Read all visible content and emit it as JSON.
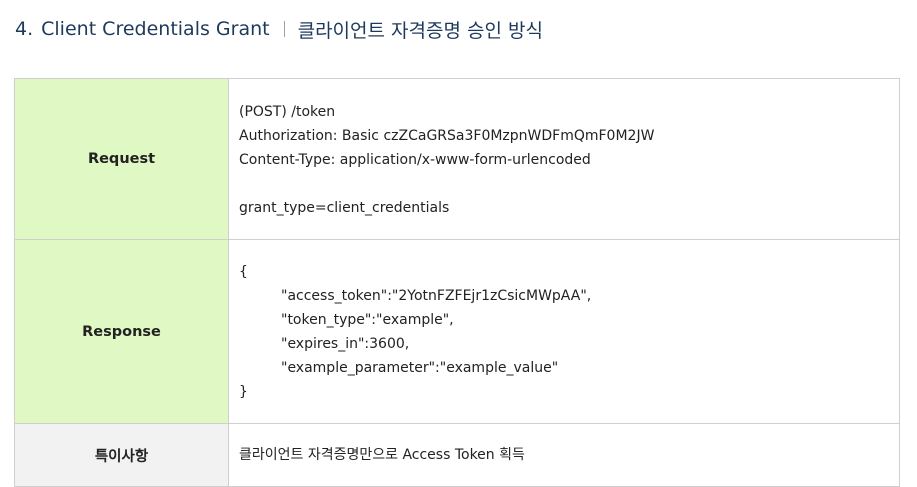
{
  "heading": {
    "number": "4.",
    "title_en": "Client Credentials Grant",
    "title_ko": "클라이언트 자격증명 승인 방식"
  },
  "table": {
    "request": {
      "label": "Request",
      "lines": [
        "(POST) /token",
        "Authorization: Basic czZCaGRSa3F0MzpnWDFmQmF0M2JW",
        "Content-Type: application/x-www-form-urlencoded",
        "",
        "grant_type=client_credentials"
      ]
    },
    "response": {
      "label": "Response",
      "open_brace": "{",
      "fields": [
        "\"access_token\":\"2YotnFZFEjr1zCsicMWpAA\",",
        "\"token_type\":\"example\",",
        "\"expires_in\":3600,",
        "\"example_parameter\":\"example_value\""
      ],
      "close_brace": "}"
    },
    "note": {
      "label": "특이사항",
      "text": "클라이언트 자격증명만으로 Access Token 획득"
    }
  }
}
